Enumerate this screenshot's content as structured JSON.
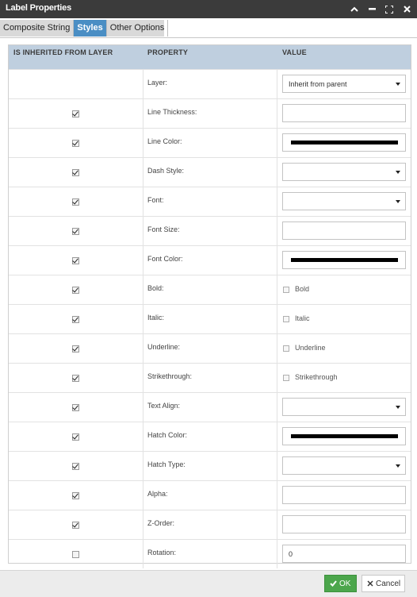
{
  "window": {
    "title": "Label Properties"
  },
  "tabs": [
    {
      "label": "Composite String"
    },
    {
      "label": "Styles"
    },
    {
      "label": "Other Options"
    }
  ],
  "active_tab": "Styles",
  "grid": {
    "headers": {
      "inherited": "IS INHERITED FROM LAYER",
      "property": "PROPERTY",
      "value": "VALUE"
    },
    "rows": [
      {
        "property": "Layer:",
        "inherited": null,
        "type": "select",
        "value": "Inherit from parent"
      },
      {
        "property": "Line Thickness:",
        "inherited": true,
        "type": "text",
        "value": ""
      },
      {
        "property": "Line Color:",
        "inherited": true,
        "type": "color",
        "value": "#000000"
      },
      {
        "property": "Dash Style:",
        "inherited": true,
        "type": "select",
        "value": ""
      },
      {
        "property": "Font:",
        "inherited": true,
        "type": "select",
        "value": ""
      },
      {
        "property": "Font Size:",
        "inherited": true,
        "type": "text",
        "value": ""
      },
      {
        "property": "Font Color:",
        "inherited": true,
        "type": "color",
        "value": "#000000"
      },
      {
        "property": "Bold:",
        "inherited": true,
        "type": "checkbox",
        "value": "Bold",
        "checked": false
      },
      {
        "property": "Italic:",
        "inherited": true,
        "type": "checkbox",
        "value": "Italic",
        "checked": false
      },
      {
        "property": "Underline:",
        "inherited": true,
        "type": "checkbox",
        "value": "Underline",
        "checked": false
      },
      {
        "property": "Strikethrough:",
        "inherited": true,
        "type": "checkbox",
        "value": "Strikethrough",
        "checked": false
      },
      {
        "property": "Text Align:",
        "inherited": true,
        "type": "select",
        "value": ""
      },
      {
        "property": "Hatch Color:",
        "inherited": true,
        "type": "color",
        "value": "#000000"
      },
      {
        "property": "Hatch Type:",
        "inherited": true,
        "type": "select",
        "value": ""
      },
      {
        "property": "Alpha:",
        "inherited": true,
        "type": "text",
        "value": ""
      },
      {
        "property": "Z-Order:",
        "inherited": true,
        "type": "text",
        "value": ""
      },
      {
        "property": "Rotation:",
        "inherited": false,
        "type": "text",
        "value": "0"
      }
    ]
  },
  "footer": {
    "ok_label": "OK",
    "cancel_label": "Cancel"
  },
  "colors": {
    "titlebar": "#3b3b3b",
    "active_tab": "#4a8ec4",
    "header_bg": "#bfcfdf",
    "ok_button": "#4ca64c"
  },
  "icons": {
    "titlebar": [
      "chevron-up-icon",
      "minimize-icon",
      "maximize-icon",
      "close-icon"
    ],
    "ok": "check-icon",
    "cancel": "x-icon"
  }
}
